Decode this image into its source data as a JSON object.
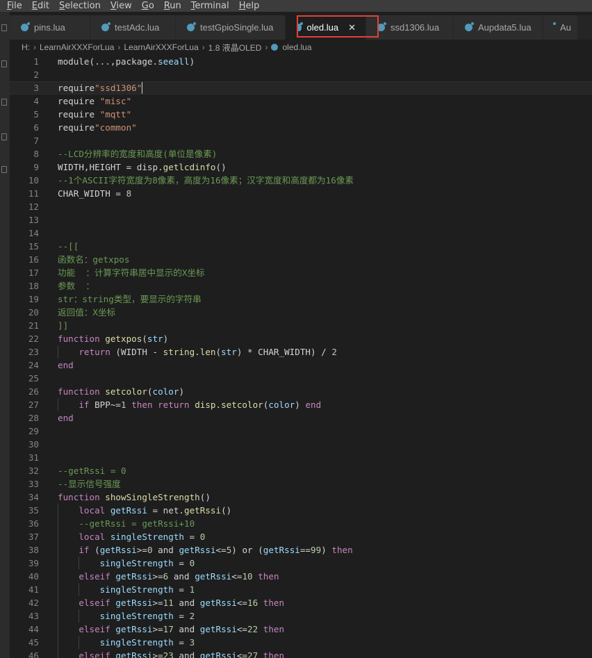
{
  "menu": [
    "File",
    "Edit",
    "Selection",
    "View",
    "Go",
    "Run",
    "Terminal",
    "Help"
  ],
  "menu_mnemonic_index": [
    0,
    0,
    0,
    0,
    0,
    0,
    0,
    0
  ],
  "tabs": [
    {
      "label": "pins.lua",
      "active": false
    },
    {
      "label": "testAdc.lua",
      "active": false
    },
    {
      "label": "testGpioSingle.lua",
      "active": false
    },
    {
      "label": "oled.lua",
      "active": true
    },
    {
      "label": "ssd1306.lua",
      "active": false
    },
    {
      "label": "Aupdata5.lua",
      "active": false
    },
    {
      "label": "Au",
      "active": false
    }
  ],
  "tab_close_glyph": "✕",
  "breadcrumb": [
    "H:",
    "LearnAirXXXForLua",
    "LearnAirXXXForLua",
    "1.8 液晶OLED",
    "oled.lua"
  ],
  "breadcrumb_sep": "›",
  "colors": {
    "keyword": "#c586c0",
    "string": "#ce9178",
    "comment": "#6a9955",
    "number": "#b5cea8",
    "function": "#dcdcaa",
    "variable": "#9cdcfe",
    "text": "#d4d4d4",
    "highlight_border": "#e0413a"
  },
  "icons": {
    "file_type": "lua-file-icon"
  },
  "editor": {
    "current_line": 3,
    "lines": [
      {
        "n": "1",
        "segs": [
          [
            "w",
            "module("
          ],
          [
            "v",
            "..."
          ],
          [
            "w",
            ",package."
          ],
          [
            "v",
            "seeall"
          ],
          [
            "w",
            ")"
          ]
        ]
      },
      {
        "n": "2",
        "segs": []
      },
      {
        "n": "3",
        "segs": [
          [
            "w",
            "require"
          ],
          [
            "s",
            "\"ssd1306\""
          ]
        ]
      },
      {
        "n": "4",
        "segs": [
          [
            "w",
            "require "
          ],
          [
            "s",
            "\"misc\""
          ]
        ]
      },
      {
        "n": "5",
        "segs": [
          [
            "w",
            "require "
          ],
          [
            "s",
            "\"mqtt\""
          ]
        ]
      },
      {
        "n": "6",
        "segs": [
          [
            "w",
            "require"
          ],
          [
            "s",
            "\"common\""
          ]
        ]
      },
      {
        "n": "7",
        "segs": []
      },
      {
        "n": "8",
        "segs": [
          [
            "c",
            "--LCD分辨率的宽度和高度(单位是像素)"
          ]
        ]
      },
      {
        "n": "9",
        "segs": [
          [
            "w",
            "WIDTH,HEIGHT = disp."
          ],
          [
            "f",
            "getlcdinfo"
          ],
          [
            "w",
            "()"
          ]
        ]
      },
      {
        "n": "10",
        "segs": [
          [
            "c",
            "--1个ASCII字符宽度为8像素，高度为16像素；汉字宽度和高度都为16像素"
          ]
        ]
      },
      {
        "n": "11",
        "segs": [
          [
            "w",
            "CHAR_WIDTH = "
          ],
          [
            "n",
            "8"
          ]
        ]
      },
      {
        "n": "12",
        "segs": []
      },
      {
        "n": "13",
        "segs": []
      },
      {
        "n": "14",
        "segs": []
      },
      {
        "n": "15",
        "segs": [
          [
            "c",
            "--[["
          ]
        ]
      },
      {
        "n": "16",
        "segs": [
          [
            "c",
            "函数名：getxpos"
          ]
        ]
      },
      {
        "n": "17",
        "segs": [
          [
            "c",
            "功能  ：计算字符串居中显示的X坐标"
          ]
        ]
      },
      {
        "n": "18",
        "segs": [
          [
            "c",
            "参数  ："
          ]
        ]
      },
      {
        "n": "19",
        "segs": [
          [
            "c",
            "str：string类型，要显示的字符串"
          ]
        ]
      },
      {
        "n": "20",
        "segs": [
          [
            "c",
            "返回值：X坐标"
          ]
        ]
      },
      {
        "n": "21",
        "segs": [
          [
            "c",
            "]]"
          ]
        ]
      },
      {
        "n": "22",
        "segs": [
          [
            "k",
            "function "
          ],
          [
            "f",
            "getxpos"
          ],
          [
            "w",
            "("
          ],
          [
            "v",
            "str"
          ],
          [
            "w",
            ")"
          ]
        ]
      },
      {
        "n": "23",
        "segs": [
          [
            "w",
            "    "
          ],
          [
            "k",
            "return "
          ],
          [
            "w",
            "(WIDTH - "
          ],
          [
            "f",
            "string.len"
          ],
          [
            "w",
            "("
          ],
          [
            "v",
            "str"
          ],
          [
            "w",
            ") * CHAR_WIDTH) / "
          ],
          [
            "n",
            "2"
          ]
        ]
      },
      {
        "n": "24",
        "segs": [
          [
            "k",
            "end"
          ]
        ]
      },
      {
        "n": "25",
        "segs": []
      },
      {
        "n": "26",
        "segs": [
          [
            "k",
            "function "
          ],
          [
            "f",
            "setcolor"
          ],
          [
            "w",
            "("
          ],
          [
            "v",
            "color"
          ],
          [
            "w",
            ")"
          ]
        ]
      },
      {
        "n": "27",
        "segs": [
          [
            "w",
            "    "
          ],
          [
            "k",
            "if "
          ],
          [
            "w",
            "BPP~="
          ],
          [
            "n",
            "1"
          ],
          [
            "k",
            " then return "
          ],
          [
            "f",
            "disp.setcolor"
          ],
          [
            "w",
            "("
          ],
          [
            "v",
            "color"
          ],
          [
            "w",
            ") "
          ],
          [
            "k",
            "end"
          ]
        ]
      },
      {
        "n": "28",
        "segs": [
          [
            "k",
            "end"
          ]
        ]
      },
      {
        "n": "29",
        "segs": []
      },
      {
        "n": "30",
        "segs": []
      },
      {
        "n": "31",
        "segs": []
      },
      {
        "n": "32",
        "segs": [
          [
            "c",
            "--getRssi = 0"
          ]
        ]
      },
      {
        "n": "33",
        "segs": [
          [
            "c",
            "--显示信号强度"
          ]
        ]
      },
      {
        "n": "34",
        "segs": [
          [
            "k",
            "function "
          ],
          [
            "f",
            "showSingleStrength"
          ],
          [
            "w",
            "()"
          ]
        ]
      },
      {
        "n": "35",
        "segs": [
          [
            "w",
            "    "
          ],
          [
            "k",
            "local "
          ],
          [
            "v",
            "getRssi"
          ],
          [
            "w",
            " = net."
          ],
          [
            "f",
            "getRssi"
          ],
          [
            "w",
            "()"
          ]
        ]
      },
      {
        "n": "36",
        "segs": [
          [
            "w",
            "    "
          ],
          [
            "c",
            "--getRssi = getRssi+10"
          ]
        ]
      },
      {
        "n": "37",
        "segs": [
          [
            "w",
            "    "
          ],
          [
            "k",
            "local "
          ],
          [
            "v",
            "singleStrength"
          ],
          [
            "w",
            " = "
          ],
          [
            "n",
            "0"
          ]
        ]
      },
      {
        "n": "38",
        "segs": [
          [
            "w",
            "    "
          ],
          [
            "k",
            "if "
          ],
          [
            "w",
            "("
          ],
          [
            "v",
            "getRssi"
          ],
          [
            "w",
            ">="
          ],
          [
            "n",
            "0"
          ],
          [
            "w",
            " and "
          ],
          [
            "v",
            "getRssi"
          ],
          [
            "w",
            "<="
          ],
          [
            "n",
            "5"
          ],
          [
            "w",
            ") or ("
          ],
          [
            "v",
            "getRssi"
          ],
          [
            "w",
            "=="
          ],
          [
            "n",
            "99"
          ],
          [
            "w",
            ") "
          ],
          [
            "k",
            "then"
          ]
        ]
      },
      {
        "n": "39",
        "segs": [
          [
            "w",
            "        "
          ],
          [
            "v",
            "singleStrength"
          ],
          [
            "w",
            " = "
          ],
          [
            "n",
            "0"
          ]
        ]
      },
      {
        "n": "40",
        "segs": [
          [
            "w",
            "    "
          ],
          [
            "k",
            "elseif "
          ],
          [
            "v",
            "getRssi"
          ],
          [
            "w",
            ">="
          ],
          [
            "n",
            "6"
          ],
          [
            "w",
            " and "
          ],
          [
            "v",
            "getRssi"
          ],
          [
            "w",
            "<="
          ],
          [
            "n",
            "10"
          ],
          [
            "k",
            " then"
          ]
        ]
      },
      {
        "n": "41",
        "segs": [
          [
            "w",
            "        "
          ],
          [
            "v",
            "singleStrength"
          ],
          [
            "w",
            " = "
          ],
          [
            "n",
            "1"
          ]
        ]
      },
      {
        "n": "42",
        "segs": [
          [
            "w",
            "    "
          ],
          [
            "k",
            "elseif "
          ],
          [
            "v",
            "getRssi"
          ],
          [
            "w",
            ">="
          ],
          [
            "n",
            "11"
          ],
          [
            "w",
            " and "
          ],
          [
            "v",
            "getRssi"
          ],
          [
            "w",
            "<="
          ],
          [
            "n",
            "16"
          ],
          [
            "k",
            " then"
          ]
        ]
      },
      {
        "n": "43",
        "segs": [
          [
            "w",
            "        "
          ],
          [
            "v",
            "singleStrength"
          ],
          [
            "w",
            " = "
          ],
          [
            "n",
            "2"
          ]
        ]
      },
      {
        "n": "44",
        "segs": [
          [
            "w",
            "    "
          ],
          [
            "k",
            "elseif "
          ],
          [
            "v",
            "getRssi"
          ],
          [
            "w",
            ">="
          ],
          [
            "n",
            "17"
          ],
          [
            "w",
            " and "
          ],
          [
            "v",
            "getRssi"
          ],
          [
            "w",
            "<="
          ],
          [
            "n",
            "22"
          ],
          [
            "k",
            " then"
          ]
        ]
      },
      {
        "n": "45",
        "segs": [
          [
            "w",
            "        "
          ],
          [
            "v",
            "singleStrength"
          ],
          [
            "w",
            " = "
          ],
          [
            "n",
            "3"
          ]
        ]
      },
      {
        "n": "46",
        "segs": [
          [
            "w",
            "    "
          ],
          [
            "k",
            "elseif "
          ],
          [
            "v",
            "getRssi"
          ],
          [
            "w",
            ">="
          ],
          [
            "n",
            "23"
          ],
          [
            "w",
            " and "
          ],
          [
            "v",
            "getRssi"
          ],
          [
            "w",
            "<="
          ],
          [
            "n",
            "27"
          ],
          [
            "k",
            " then"
          ]
        ]
      }
    ]
  }
}
